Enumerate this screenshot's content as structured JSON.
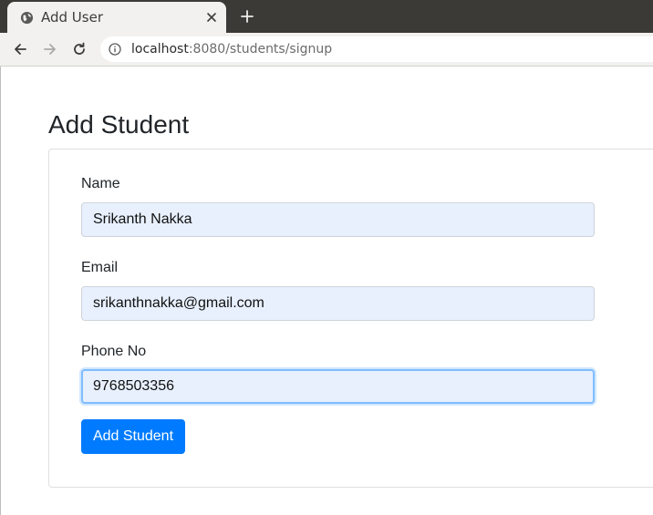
{
  "browser": {
    "tab": {
      "title": "Add User",
      "favicon": "globe-icon",
      "close_icon": "close-icon"
    },
    "new_tab_icon": "plus-icon",
    "nav": {
      "back_icon": "back-arrow-icon",
      "forward_icon": "forward-arrow-icon",
      "reload_icon": "reload-icon"
    },
    "address": {
      "info_icon": "info-icon",
      "host": "localhost",
      "rest": ":8080/students/signup"
    }
  },
  "page": {
    "title": "Add Student",
    "form": {
      "name": {
        "label": "Name",
        "value": "Srikanth Nakka"
      },
      "email": {
        "label": "Email",
        "value": "srikanthnakka@gmail.com"
      },
      "phone": {
        "label": "Phone No",
        "value": "9768503356"
      },
      "submit_label": "Add Student"
    }
  },
  "colors": {
    "chrome_dark": "#3b3a36",
    "chrome_light": "#f2f1ef",
    "primary": "#007bff",
    "autofill_bg": "#e8f0fe",
    "focus_border": "#80bdff"
  }
}
